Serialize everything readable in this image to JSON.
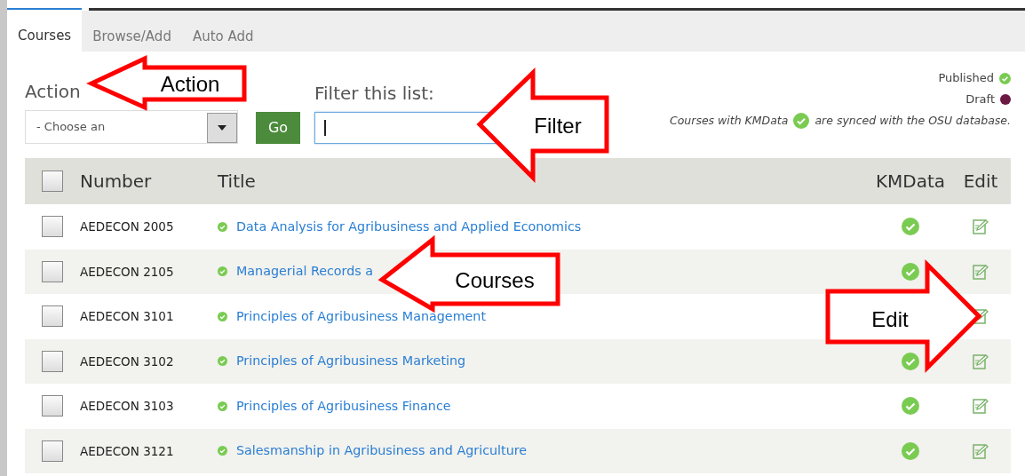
{
  "tabs": [
    {
      "label": "Courses",
      "selected": true
    },
    {
      "label": "Browse/Add",
      "selected": false
    },
    {
      "label": "Auto Add",
      "selected": false
    }
  ],
  "action": {
    "label": "Action",
    "select": "- Choose an",
    "button": "Go"
  },
  "filter": {
    "label": "Filter this list:",
    "focused": true
  },
  "legend": [
    {
      "label": "Published",
      "kind": "check"
    },
    {
      "label": "Draft",
      "kind": "dot",
      "color": "#6b1842"
    }
  ],
  "note": {
    "before": "Courses with KMData",
    "after": "are synced with the OSU database."
  },
  "table": {
    "select_all_checked": false,
    "columns": [
      "Number",
      "Title",
      "KMData",
      "Edit"
    ],
    "rows": [
      {
        "checked": false,
        "number": "AEDECON 2005",
        "published": true,
        "title": "Data Analysis for Agribusiness and Applied Economics",
        "kmdata": true
      },
      {
        "checked": false,
        "number": "AEDECON 2105",
        "published": true,
        "title": "Managerial Records a",
        "kmdata": true
      },
      {
        "checked": false,
        "number": "AEDECON 3101",
        "published": true,
        "title": "Principles of Agribusiness Management"
      },
      {
        "checked": false,
        "number": "AEDECON 3102",
        "published": true,
        "title": "Principles of Agribusiness Marketing",
        "kmdata": true
      },
      {
        "checked": false,
        "number": "AEDECON 3103",
        "published": true,
        "title": "Principles of Agribusiness Finance",
        "kmdata": true
      },
      {
        "checked": false,
        "number": "AEDECON 3121",
        "published": true,
        "title": "Salesmanship in Agribusiness and Agriculture",
        "kmdata": true
      }
    ]
  },
  "callouts": [
    {
      "label": "Action"
    },
    {
      "label": "Filter"
    },
    {
      "label": "Courses"
    },
    {
      "label": "Edit"
    }
  ]
}
